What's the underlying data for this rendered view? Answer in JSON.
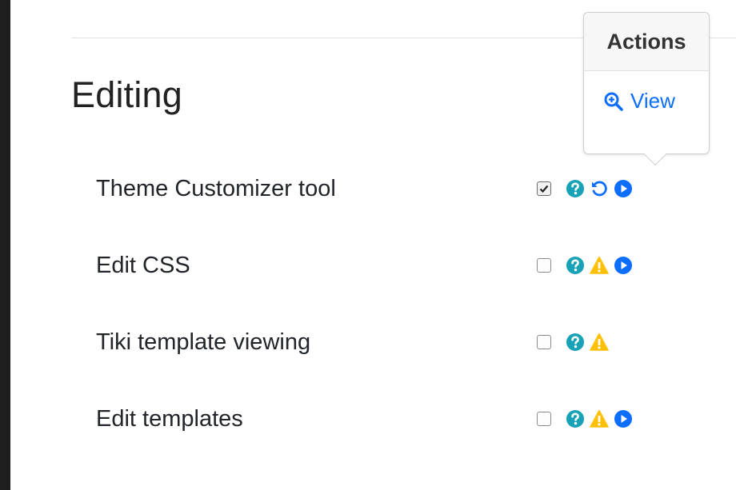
{
  "section": {
    "title": "Editing"
  },
  "preferences": [
    {
      "label": "Theme Customizer tool",
      "checked": true,
      "icons": [
        "help-icon",
        "reset-icon",
        "play-icon"
      ]
    },
    {
      "label": "Edit CSS",
      "checked": false,
      "icons": [
        "help-icon",
        "warning-icon",
        "play-icon"
      ]
    },
    {
      "label": "Tiki template viewing",
      "checked": false,
      "icons": [
        "help-icon",
        "warning-icon"
      ]
    },
    {
      "label": "Edit templates",
      "checked": false,
      "icons": [
        "help-icon",
        "warning-icon",
        "play-icon"
      ]
    }
  ],
  "popover": {
    "title": "Actions",
    "view_label": "View",
    "view_icon": "zoom-in-icon"
  },
  "colors": {
    "help": "#17a2b8",
    "warning": "#ffc107",
    "link": "#0d6efd"
  }
}
